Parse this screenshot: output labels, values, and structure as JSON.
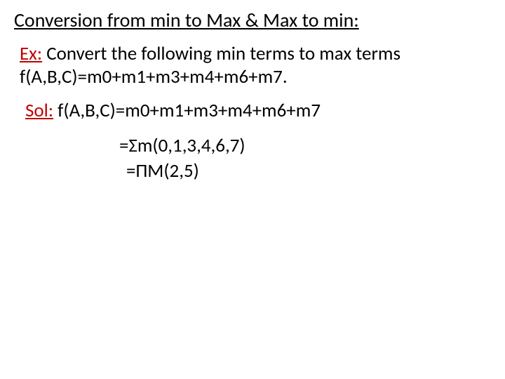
{
  "title": {
    "text": "Conversion from min to Max & Max to min:"
  },
  "example": {
    "label": "Ex:",
    "prompt": " Convert the following min terms to max terms",
    "equation": "f(A,B,C)=m0+m1+m3+m4+m6+m7."
  },
  "solution": {
    "label": "Sol:",
    "restate": " f(A,B,C)=m0+m1+m3+m4+m6+m7",
    "step_sigma": "=Σm(0,1,3,4,6,7)",
    "step_pi": "=ΠM(2,5)"
  }
}
